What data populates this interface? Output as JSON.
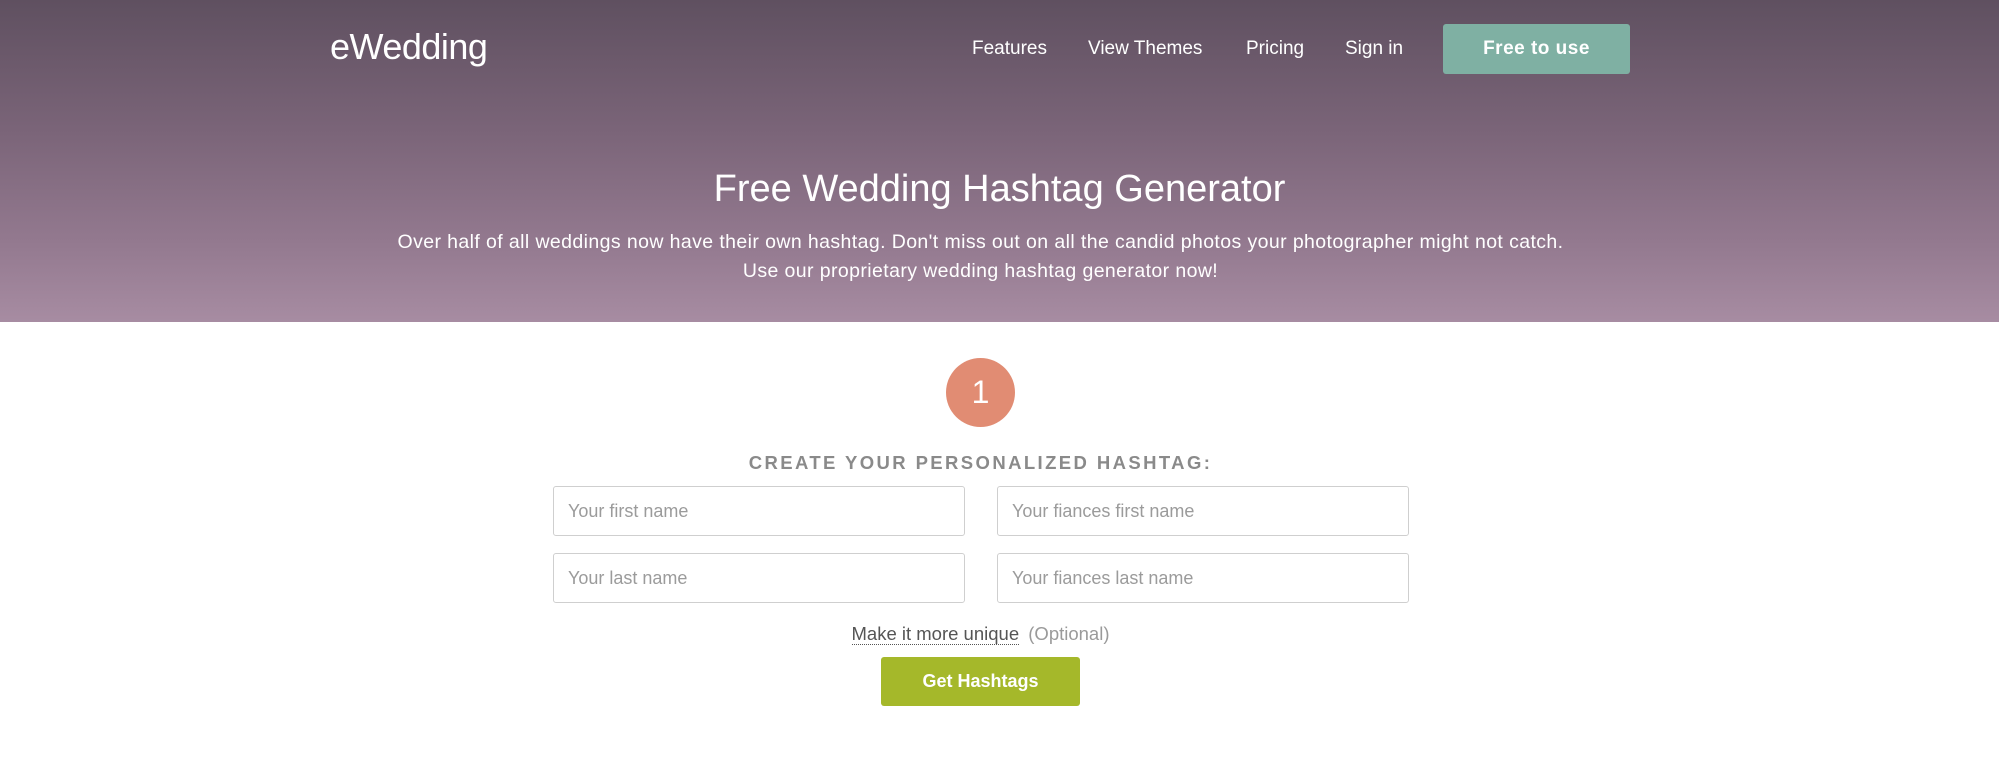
{
  "header": {
    "logo": "eWedding",
    "nav": [
      {
        "label": "Features"
      },
      {
        "label": "View Themes"
      },
      {
        "label": "Pricing"
      },
      {
        "label": "Sign in"
      }
    ],
    "cta_label": "Free to use"
  },
  "hero": {
    "title": "Free Wedding Hashtag Generator",
    "subtitle_line1": "Over half of all weddings now have their own hashtag. Don't miss out on all the candid photos your photographer might not catch.",
    "subtitle_line2": "Use our proprietary wedding hashtag generator now!"
  },
  "form": {
    "step_number": "1",
    "title": "CREATE YOUR PERSONALIZED HASHTAG:",
    "first_name": {
      "value": "",
      "placeholder": "Your first name"
    },
    "fiance_first_name": {
      "value": "",
      "placeholder": "Your fiances first name"
    },
    "last_name": {
      "value": "",
      "placeholder": "Your last name"
    },
    "fiance_last_name": {
      "value": "",
      "placeholder": "Your fiances last name"
    },
    "unique_link": "Make it more unique",
    "unique_optional": "(Optional)",
    "submit_label": "Get Hashtags"
  },
  "colors": {
    "cta": "#7fb0a3",
    "step_circle": "#e18c73",
    "submit": "#a5b82a",
    "hero_top": "#5f5060",
    "hero_bottom": "#a78ca2"
  }
}
